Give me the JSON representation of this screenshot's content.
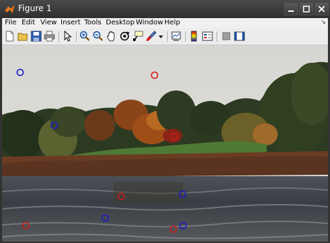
{
  "window": {
    "title": "Figure 1"
  },
  "menubar": {
    "items": [
      "File",
      "Edit",
      "View",
      "Insert",
      "Tools",
      "Desktop",
      "Window",
      "Help"
    ]
  },
  "colors": {
    "marker_blue": "#1a1acc",
    "marker_red": "#d11a1a",
    "titlebar": "#3a3a3a",
    "menubar": "#f0f0f0"
  },
  "toolbar": {
    "icons": [
      "new-figure-icon",
      "open-file-icon",
      "save-icon",
      "print-icon",
      "edit-plot-arrow-icon",
      "zoom-in-icon",
      "zoom-out-icon",
      "pan-hand-icon",
      "rotate-3d-icon",
      "data-cursor-icon",
      "brush-icon",
      "brush-dropdown-icon",
      "link-plot-icon",
      "insert-colorbar-icon",
      "insert-legend-icon",
      "hide-plot-tools-icon",
      "show-plot-tools-icon"
    ]
  },
  "markers": {
    "blue_count": 5,
    "red_count": 6
  }
}
